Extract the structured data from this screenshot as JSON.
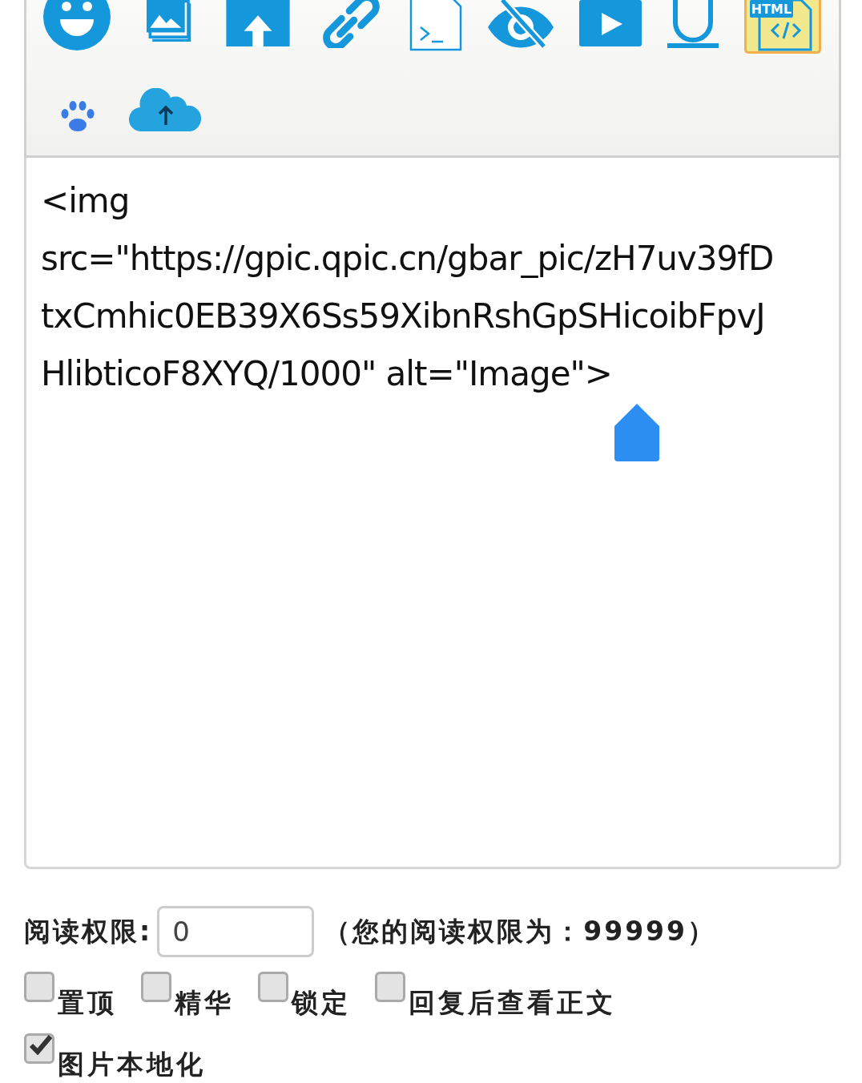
{
  "toolbar": {
    "rows": [
      [
        {
          "kind": "emoji",
          "selected": false
        },
        {
          "kind": "images",
          "selected": false
        },
        {
          "kind": "upload-folder",
          "selected": false
        },
        {
          "kind": "link",
          "selected": false
        },
        {
          "kind": "terminal",
          "selected": false
        },
        {
          "kind": "hidden",
          "selected": false
        },
        {
          "kind": "video",
          "selected": false
        },
        {
          "kind": "underline",
          "selected": false
        },
        {
          "kind": "html",
          "selected": true,
          "badge": "HTML"
        }
      ],
      [
        {
          "kind": "paw",
          "selected": false
        },
        {
          "kind": "cloud-upload",
          "selected": false
        }
      ]
    ]
  },
  "editor": {
    "lines": [
      "<img",
      "src=\"https://gpic.qpic.cn/gbar_pic/zH7uv39fD",
      "txCmhic0EB39X6Ss59XibnRshGpSHicoibFpvJ",
      "HlibticoF8XYQ/1000\" alt=\"Image\">"
    ],
    "cursor_handle": true
  },
  "read_permission": {
    "label": "阅读权限:",
    "value": "0",
    "note": "（您的阅读权限为：99999）"
  },
  "options": [
    {
      "label": "置顶",
      "checked": false
    },
    {
      "label": "精华",
      "checked": false
    },
    {
      "label": "锁定",
      "checked": false
    },
    {
      "label": "回复后查看正文",
      "checked": false
    },
    {
      "label": "图片本地化",
      "checked": true
    }
  ]
}
